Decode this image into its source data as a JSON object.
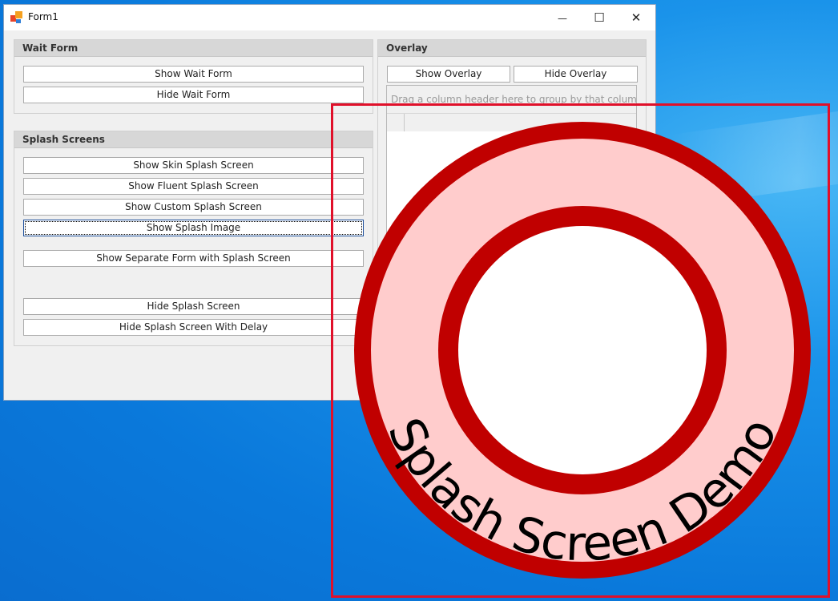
{
  "window": {
    "title": "Form1",
    "minimize_glyph": "—",
    "maximize_glyph": "☐",
    "close_glyph": "✕"
  },
  "wait_form": {
    "header": "Wait Form",
    "show_label": "Show Wait Form",
    "hide_label": "Hide Wait Form"
  },
  "splash_screens": {
    "header": "Splash Screens",
    "buttons": [
      "Show Skin Splash Screen",
      "Show Fluent Splash Screen",
      "Show Custom Splash Screen",
      "Show Splash Image",
      "Show Separate Form with Splash Screen",
      "Hide Splash Screen",
      "Hide Splash Screen With Delay"
    ]
  },
  "overlay": {
    "header": "Overlay",
    "show_label": "Show Overlay",
    "hide_label": "Hide Overlay",
    "grid_hint": "Drag a column header here to group by that column"
  },
  "splash_image": {
    "text": "Splash Screen Demo",
    "ring_color": "#c00000",
    "band_color": "#ffcccc",
    "frame_color": "#e0102a"
  }
}
